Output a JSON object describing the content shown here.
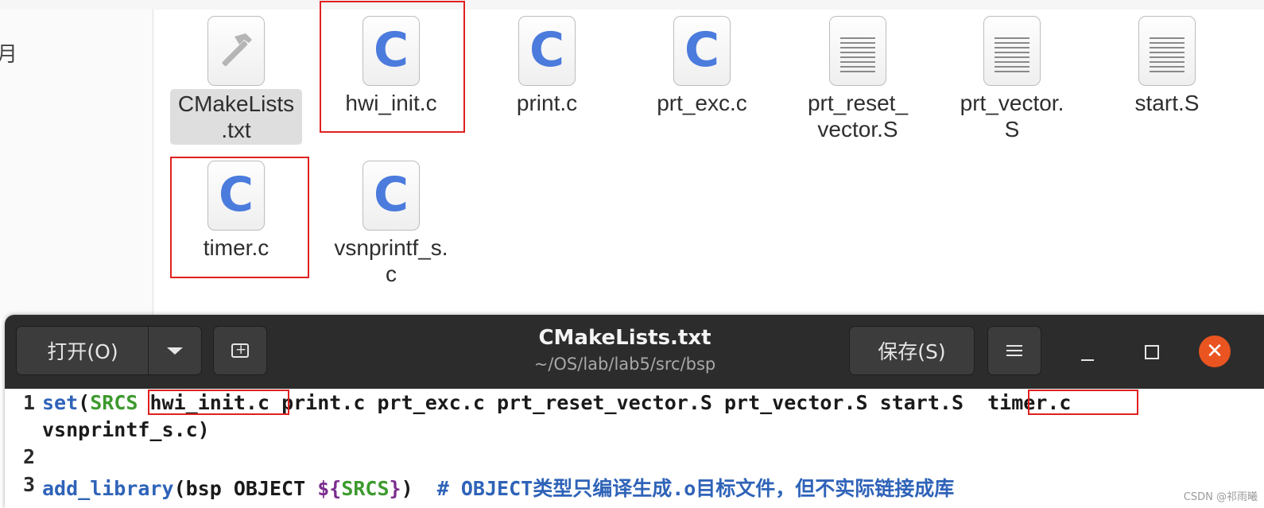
{
  "file_manager": {
    "sidebar_glyph": "月",
    "files": [
      {
        "name": "CMakeLists\n.txt",
        "icon": "hammer-icon"
      },
      {
        "name": "hwi_init.c",
        "icon": "c-file-icon"
      },
      {
        "name": "print.c",
        "icon": "c-file-icon"
      },
      {
        "name": "prt_exc.c",
        "icon": "c-file-icon"
      },
      {
        "name": "prt_reset_\nvector.S",
        "icon": "text-file-icon"
      },
      {
        "name": "prt_vector.\nS",
        "icon": "text-file-icon"
      },
      {
        "name": "start.S",
        "icon": "text-file-icon"
      },
      {
        "name": "timer.c",
        "icon": "c-file-icon"
      },
      {
        "name": "vsnprintf_s.\nc",
        "icon": "c-file-icon"
      }
    ],
    "c_glyph": "C"
  },
  "editor": {
    "open_label": "打开(O)",
    "save_label": "保存(S)",
    "title": "CMakeLists.txt",
    "subtitle": "~/OS/lab/lab5/src/bsp",
    "close_glyph": "✕",
    "lines": [
      {
        "num": "1"
      },
      {
        "num": "2"
      },
      {
        "num": "3"
      }
    ],
    "code": {
      "l1_set": "set",
      "l1_paren": "(",
      "l1_srcs": "SRCS",
      "l1_hwi": "hwi_init.c",
      "l1_mid": "print.c prt_exc.c prt_reset_vector.S prt_vector.S start.S",
      "l1_timer": "timer.c",
      "l1_cont": "vsnprintf_s.c)",
      "l3_fn": "add_library",
      "l3_args": "(bsp OBJECT ",
      "l3_dollar": "$",
      "l3_brace_open": "{",
      "l3_srcs": "SRCS",
      "l3_brace_close": "}",
      "l3_close": ")",
      "l3_comment": "# OBJECT类型只编译生成.o目标文件，但不实际链接成库"
    }
  },
  "watermark": "CSDN @祁雨曦",
  "colors": {
    "highlight_box": "#e02020",
    "c_icon": "#4b7bdc",
    "header_bg": "#2c2c2c",
    "close_button": "#e95420",
    "keyword_blue": "#2f63b8",
    "keyword_green": "#3d9a2e"
  }
}
